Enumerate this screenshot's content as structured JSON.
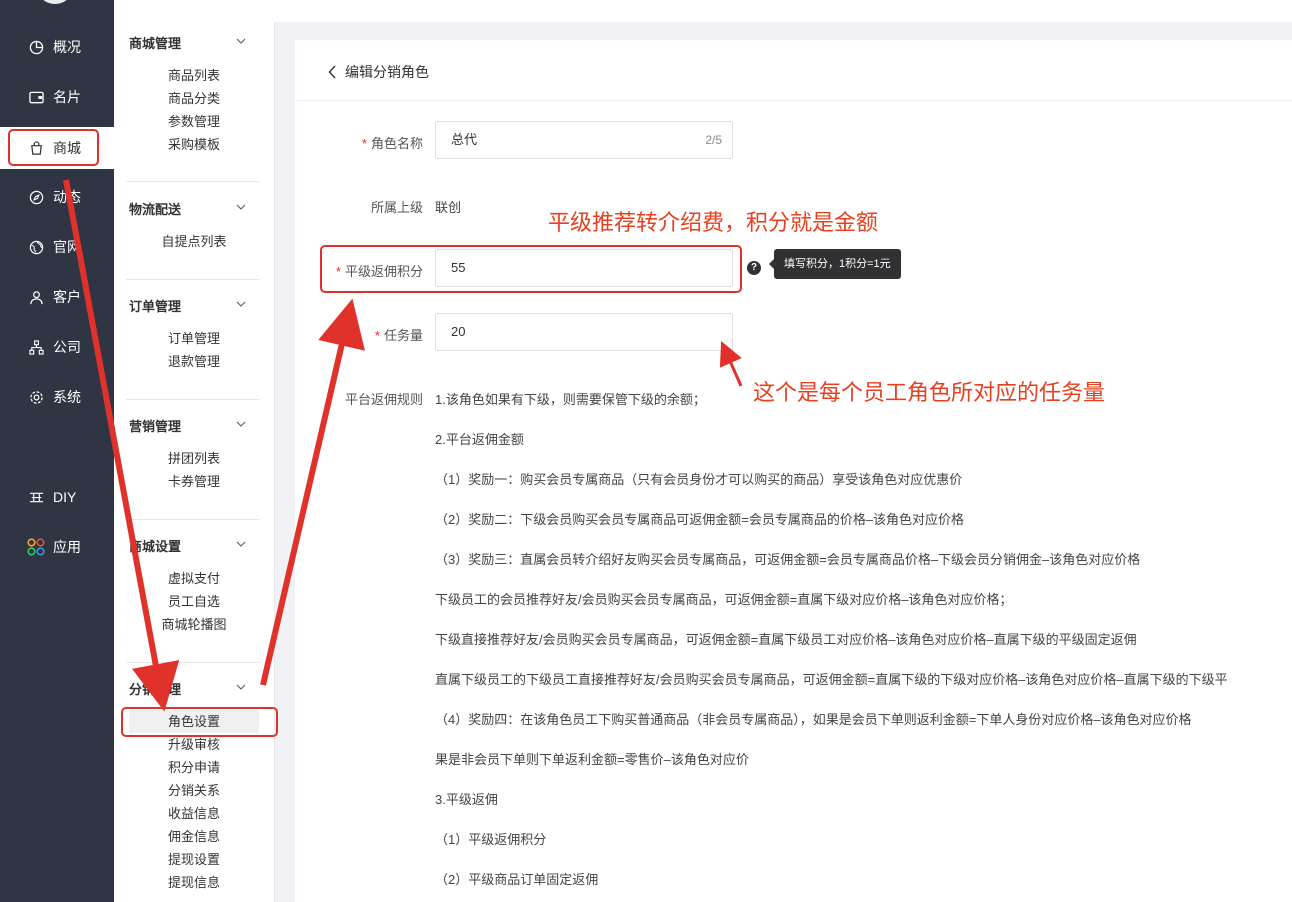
{
  "rail": {
    "items": [
      {
        "label": "概况",
        "icon": "pie-chart-icon"
      },
      {
        "label": "名片",
        "icon": "card-icon"
      },
      {
        "label": "商城",
        "icon": "shopping-bag-icon"
      },
      {
        "label": "动态",
        "icon": "compass-icon"
      },
      {
        "label": "官网",
        "icon": "globe-icon"
      },
      {
        "label": "客户",
        "icon": "user-icon"
      },
      {
        "label": "公司",
        "icon": "org-chart-icon"
      },
      {
        "label": "系统",
        "icon": "gear-icon"
      },
      {
        "label": "DIY",
        "icon": "layers-icon"
      },
      {
        "label": "应用",
        "icon": "apps-grid-icon"
      }
    ]
  },
  "menu": {
    "groups": [
      {
        "title": "商城管理",
        "items": [
          "商品列表",
          "商品分类",
          "参数管理",
          "采购模板"
        ]
      },
      {
        "title": "物流配送",
        "items": [
          "自提点列表"
        ]
      },
      {
        "title": "订单管理",
        "items": [
          "订单管理",
          "退款管理"
        ]
      },
      {
        "title": "营销管理",
        "items": [
          "拼团列表",
          "卡券管理"
        ]
      },
      {
        "title": "商城设置",
        "items": [
          "虚拟支付",
          "员工自选",
          "商城轮播图"
        ]
      },
      {
        "title": "分销管理",
        "items": [
          "角色设置",
          "升级审核",
          "积分申请",
          "分销关系",
          "收益信息",
          "佣金信息",
          "提现设置",
          "提现信息"
        ]
      }
    ]
  },
  "page": {
    "back_title": "编辑分销角色",
    "role_name_label": "角色名称",
    "role_name_value": "总代",
    "role_name_count": "2/5",
    "parent_label": "所属上级",
    "parent_value": "联创",
    "peer_points_label": "平级返佣积分",
    "peer_points_value": "55",
    "tooltip_icon": "?",
    "tooltip_text": "填写积分，1积分=1元",
    "task_label": "任务量",
    "task_value": "20",
    "rules_label": "平台返佣规则",
    "rules": [
      "1.该角色如果有下级，则需要保管下级的余额；",
      "2.平台返佣金额",
      "（1）奖励一：购买会员专属商品（只有会员身份才可以购买的商品）享受该角色对应优惠价",
      "（2）奖励二：下级会员购买会员专属商品可返佣金额=会员专属商品的价格–该角色对应价格",
      "（3）奖励三：直属会员转介绍好友购买会员专属商品，可返佣金额=会员专属商品价格–下级会员分销佣金–该角色对应价格",
      "下级员工的会员推荐好友/会员购买会员专属商品，可返佣金额=直属下级对应价格–该角色对应价格；",
      "下级直接推荐好友/会员购买会员专属商品，可返佣金额=直属下级员工对应价格–该角色对应价格–直属下级的平级固定返佣",
      "直属下级员工的下级员工直接推荐好友/会员购买会员专属商品，可返佣金额=直属下级的下级对应价格–该角色对应价格–直属下级的下级平",
      "（4）奖励四：在该角色员工下购买普通商品（非会员专属商品），如果是会员下单则返利金额=下单人身份对应价格–该角色对应价格",
      "果是非会员下单则下单返利金额=零售价–该角色对应价",
      "3.平级返佣",
      "（1）平级返佣积分",
      "（2）平级商品订单固定返佣"
    ]
  },
  "annotations": {
    "peer_note": "平级推荐转介绍费，积分就是金额",
    "task_note": "这个是每个员工角色所对应的任务量",
    "color": "#e8401f"
  }
}
